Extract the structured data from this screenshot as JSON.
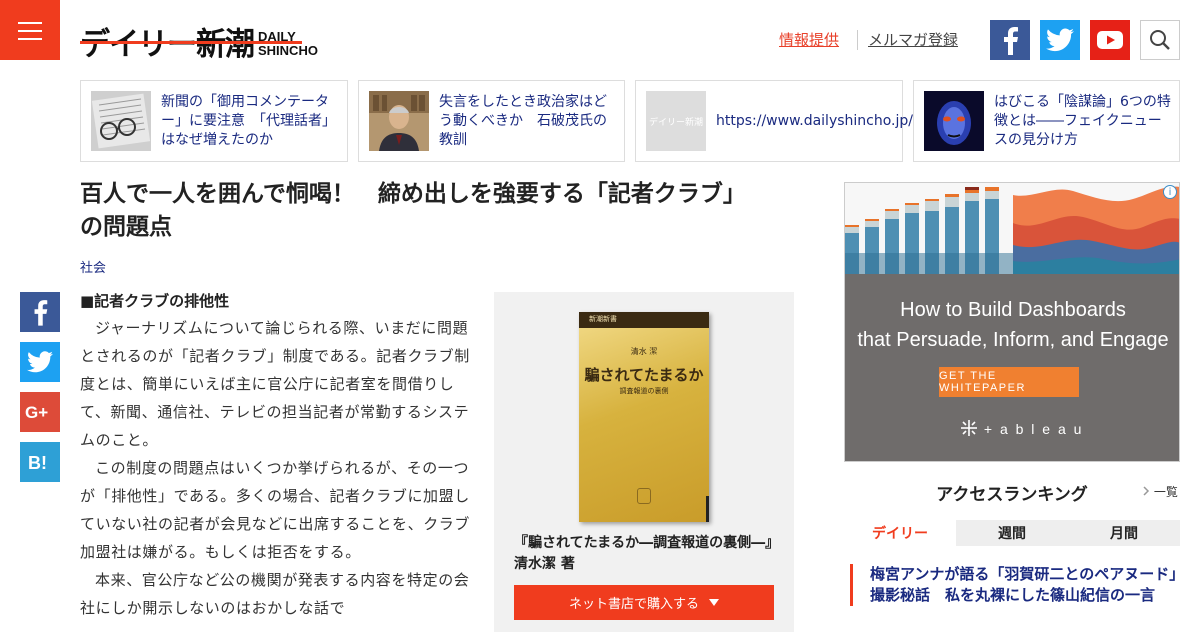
{
  "header": {
    "logo_jp": "デイリー新潮",
    "logo_en_line1": "DAILY",
    "logo_en_line2": "SHINCHO",
    "info_link": "情報提供",
    "newsletter_link": "メルマガ登録"
  },
  "related": [
    {
      "text": "新聞の「御用コメンテーター」に要注意　「代理話者」はなぜ増えたのか"
    },
    {
      "text": "失言をしたとき政治家はどう動くべきか　石破茂氏の教訓"
    },
    {
      "text": "https://www.dailyshincho.jp/articl...",
      "thumb_label": "デイリー新潮"
    },
    {
      "text": "はびこる「陰謀論」6つの特徴とは――フェイクニュースの見分け方"
    }
  ],
  "article": {
    "title": "百人で一人を囲んで恫喝！　締め出しを強要する「記者クラブ」の問題点",
    "category": "社会",
    "subheading": "■記者クラブの排他性",
    "paragraphs": [
      "ジャーナリズムについて論じられる際、いまだに問題とされるのが「記者クラブ」制度である。記者クラブ制度とは、簡単にいえば主に官公庁に記者室を間借りして、新聞、通信社、テレビの担当記者が常勤するシステムのこと。",
      "この制度の問題点はいくつか挙げられるが、その一つが「排他性」である。多くの場合、記者クラブに加盟していない社の記者が会見などに出席することを、クラブ加盟社は嫌がる。もしくは拒否をする。",
      "本来、官公庁など公の機関が発表する内容を特定の会社にしか開示しないのはおかしな話で"
    ]
  },
  "book": {
    "series": "新潮新書",
    "author": "清水 潔",
    "cover_title": "騙されてたまるか",
    "cover_subtitle": "調査報道の裏側",
    "caption": "『騙されてたまるか―調査報道の裏側―』清水潔 著",
    "buy_label": "ネット書店で購入する"
  },
  "ad": {
    "headline_line1": "How to Build Dashboards",
    "headline_line2": "that Persuade, Inform, and Engage",
    "cta": "GET THE WHITEPAPER",
    "brand": "+ a b l e a u"
  },
  "ranking": {
    "title": "アクセスランキング",
    "more": "一覧",
    "tabs": [
      "デイリー",
      "週間",
      "月間"
    ],
    "items": [
      "梅宮アンナが語る「羽賀研二とのペアヌード」撮影秘話　私を丸裸にした篠山紀信の一言"
    ]
  },
  "colors": {
    "brand_red": "#f03c1e",
    "link_blue": "#1a2a80",
    "facebook": "#3b5998",
    "twitter": "#1da1f2",
    "youtube": "#e62117",
    "googleplus": "#dd4b39",
    "hatena": "#2ea0d6"
  }
}
